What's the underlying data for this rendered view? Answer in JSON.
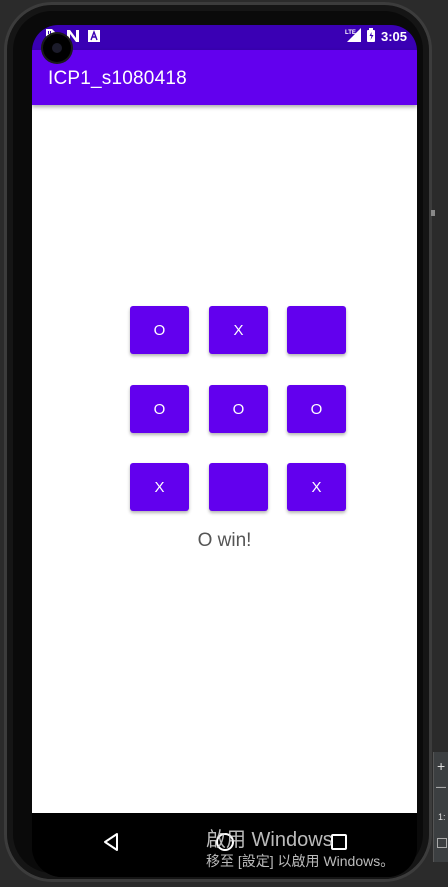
{
  "status_bar": {
    "time": "3:05",
    "network": "LTE",
    "left_icons": [
      "sim-card-icon",
      "n-logo-icon",
      "app-notification-icon"
    ],
    "right_icons": [
      "lte-signal-icon",
      "battery-icon"
    ]
  },
  "app_bar": {
    "title": "ICP1_s1080418"
  },
  "board": {
    "cells": [
      "O",
      "X",
      "",
      "O",
      "O",
      "O",
      "X",
      "",
      "X"
    ]
  },
  "result_text": "O win!",
  "nav_bar": {
    "buttons": [
      "back-icon",
      "home-icon",
      "recents-icon"
    ]
  },
  "watermark": {
    "line1": "啟用 Windows",
    "line2": "移至 [設定] 以啟用 Windows。"
  },
  "side_panel": {
    "plus": "+",
    "minus": "—",
    "number": "1:"
  },
  "colors": {
    "primary": "#6200ee",
    "status_bar": "#3a00b4",
    "button_text": "#ffffff",
    "result_text": "#555555"
  }
}
